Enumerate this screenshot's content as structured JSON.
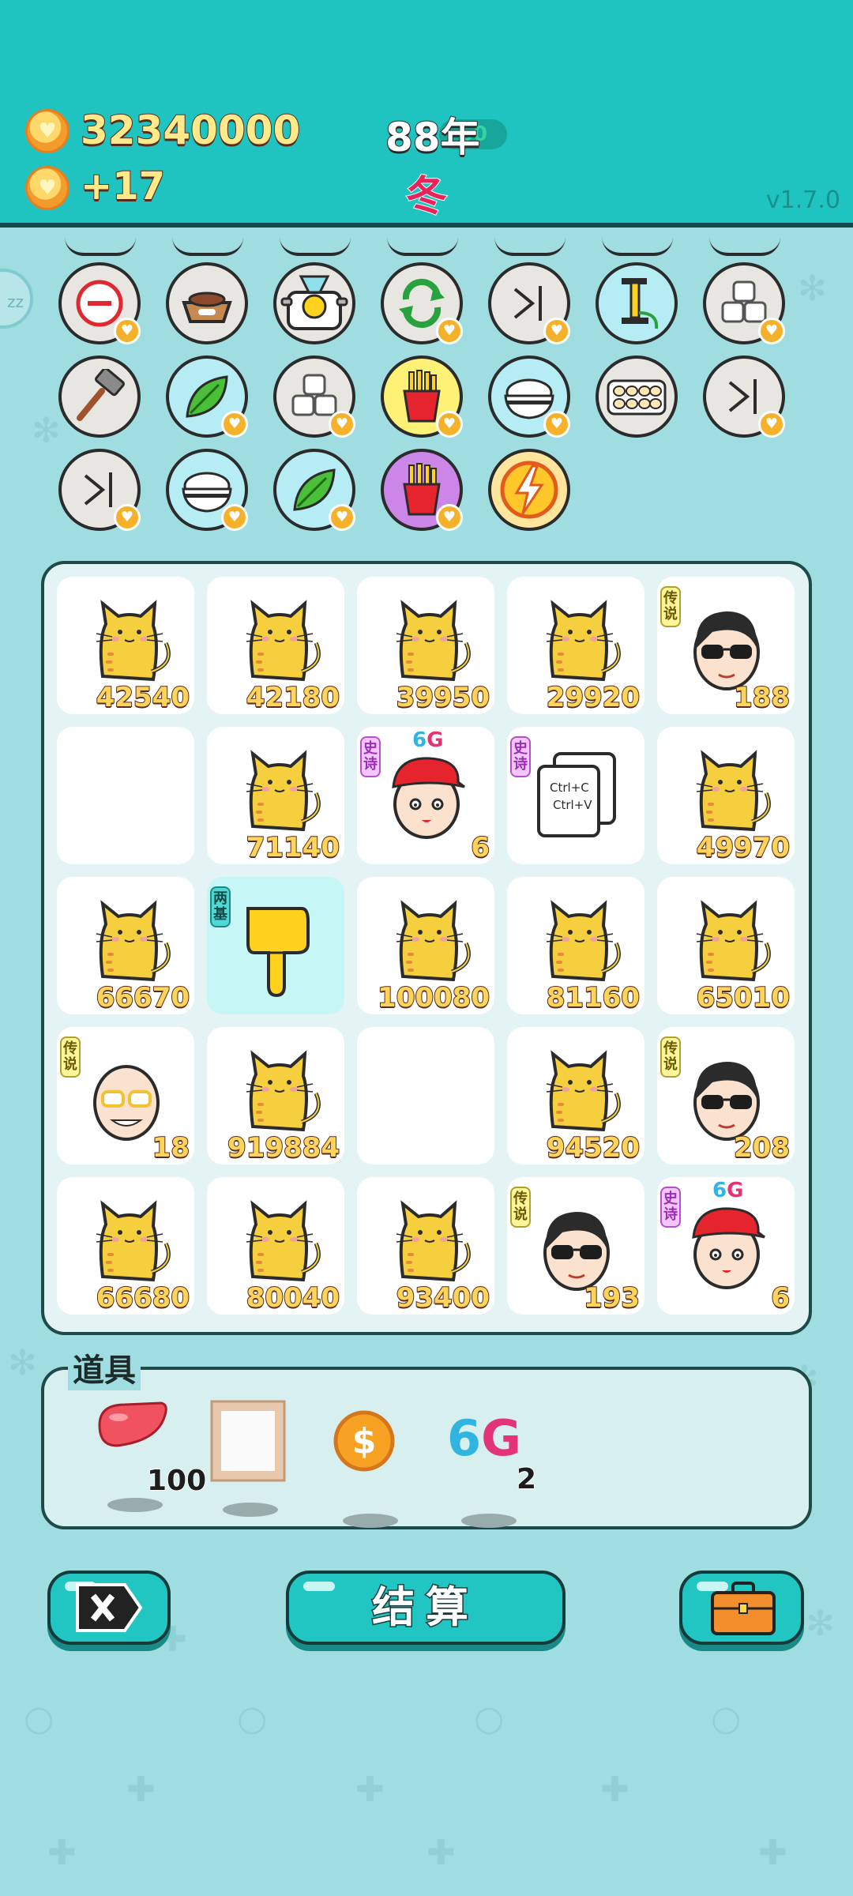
{
  "header": {
    "coins": "32340000",
    "income": "+17",
    "year": "88年",
    "year_pill": "60",
    "season": "冬",
    "version": "v1.7.0"
  },
  "side_bubble": "zz",
  "top_items": [
    {
      "name": "minus",
      "color": "grey"
    },
    {
      "name": "pet-food-bowl",
      "color": "grey"
    },
    {
      "name": "duck-pot",
      "color": "grey"
    },
    {
      "name": "refresh",
      "color": "grey"
    },
    {
      "name": "skip",
      "color": "grey"
    },
    {
      "name": "pump",
      "color": "blue"
    },
    {
      "name": "sugar-cubes",
      "color": "grey"
    },
    {
      "name": "hammer",
      "color": "grey"
    },
    {
      "name": "leaf",
      "color": "blue"
    },
    {
      "name": "sugar-cubes",
      "color": "grey"
    },
    {
      "name": "fries",
      "color": "yellow"
    },
    {
      "name": "rice-bowl",
      "color": "blue"
    },
    {
      "name": "egg-tray",
      "color": "grey"
    },
    {
      "name": "skip",
      "color": "grey"
    },
    {
      "name": "skip",
      "color": "grey"
    },
    {
      "name": "rice-bowl",
      "color": "blue"
    },
    {
      "name": "leaf",
      "color": "blue"
    },
    {
      "name": "fries",
      "color": "purple"
    },
    {
      "name": "lightning",
      "color": "orange"
    }
  ],
  "grid": [
    {
      "type": "cat",
      "value": "42540"
    },
    {
      "type": "cat",
      "value": "42180"
    },
    {
      "type": "cat",
      "value": "39950"
    },
    {
      "type": "cat",
      "value": "29920"
    },
    {
      "type": "man-sunglasses",
      "value": "188",
      "tag": "传说"
    },
    {
      "type": "empty",
      "value": ""
    },
    {
      "type": "cat",
      "value": "71140"
    },
    {
      "type": "boy-red-cap",
      "value": "6",
      "tag": "史诗",
      "sixg": true
    },
    {
      "type": "ctrl-cv",
      "value": "",
      "tag": "史诗",
      "copy": "Ctrl+C",
      "paste": "Ctrl+V"
    },
    {
      "type": "cat",
      "value": "49970"
    },
    {
      "type": "cat",
      "value": "66670"
    },
    {
      "type": "pointing-hand",
      "value": "",
      "tag": "两基",
      "highlight": true
    },
    {
      "type": "cat",
      "value": "100080"
    },
    {
      "type": "cat",
      "value": "81160"
    },
    {
      "type": "cat",
      "value": "65010"
    },
    {
      "type": "old-man-glasses",
      "value": "18",
      "tag": "传说"
    },
    {
      "type": "cat",
      "value": "919884"
    },
    {
      "type": "empty",
      "value": ""
    },
    {
      "type": "cat",
      "value": "94520"
    },
    {
      "type": "man-sunglasses",
      "value": "208",
      "tag": "传说"
    },
    {
      "type": "cat",
      "value": "66680"
    },
    {
      "type": "cat",
      "value": "80040"
    },
    {
      "type": "cat",
      "value": "93400"
    },
    {
      "type": "man-sunglasses",
      "value": "193",
      "tag": "传说"
    },
    {
      "type": "boy-red-cap",
      "value": "6",
      "tag": "史诗",
      "sixg": true
    }
  ],
  "sixg_label": {
    "a": "6",
    "b": "G"
  },
  "props": {
    "title": "道具",
    "items": [
      {
        "name": "liver",
        "count": "100"
      },
      {
        "name": "frame",
        "count": ""
      },
      {
        "name": "coin",
        "count": ""
      },
      {
        "name": "6g",
        "count": "2"
      }
    ]
  },
  "buttons": {
    "settle": "结算"
  }
}
